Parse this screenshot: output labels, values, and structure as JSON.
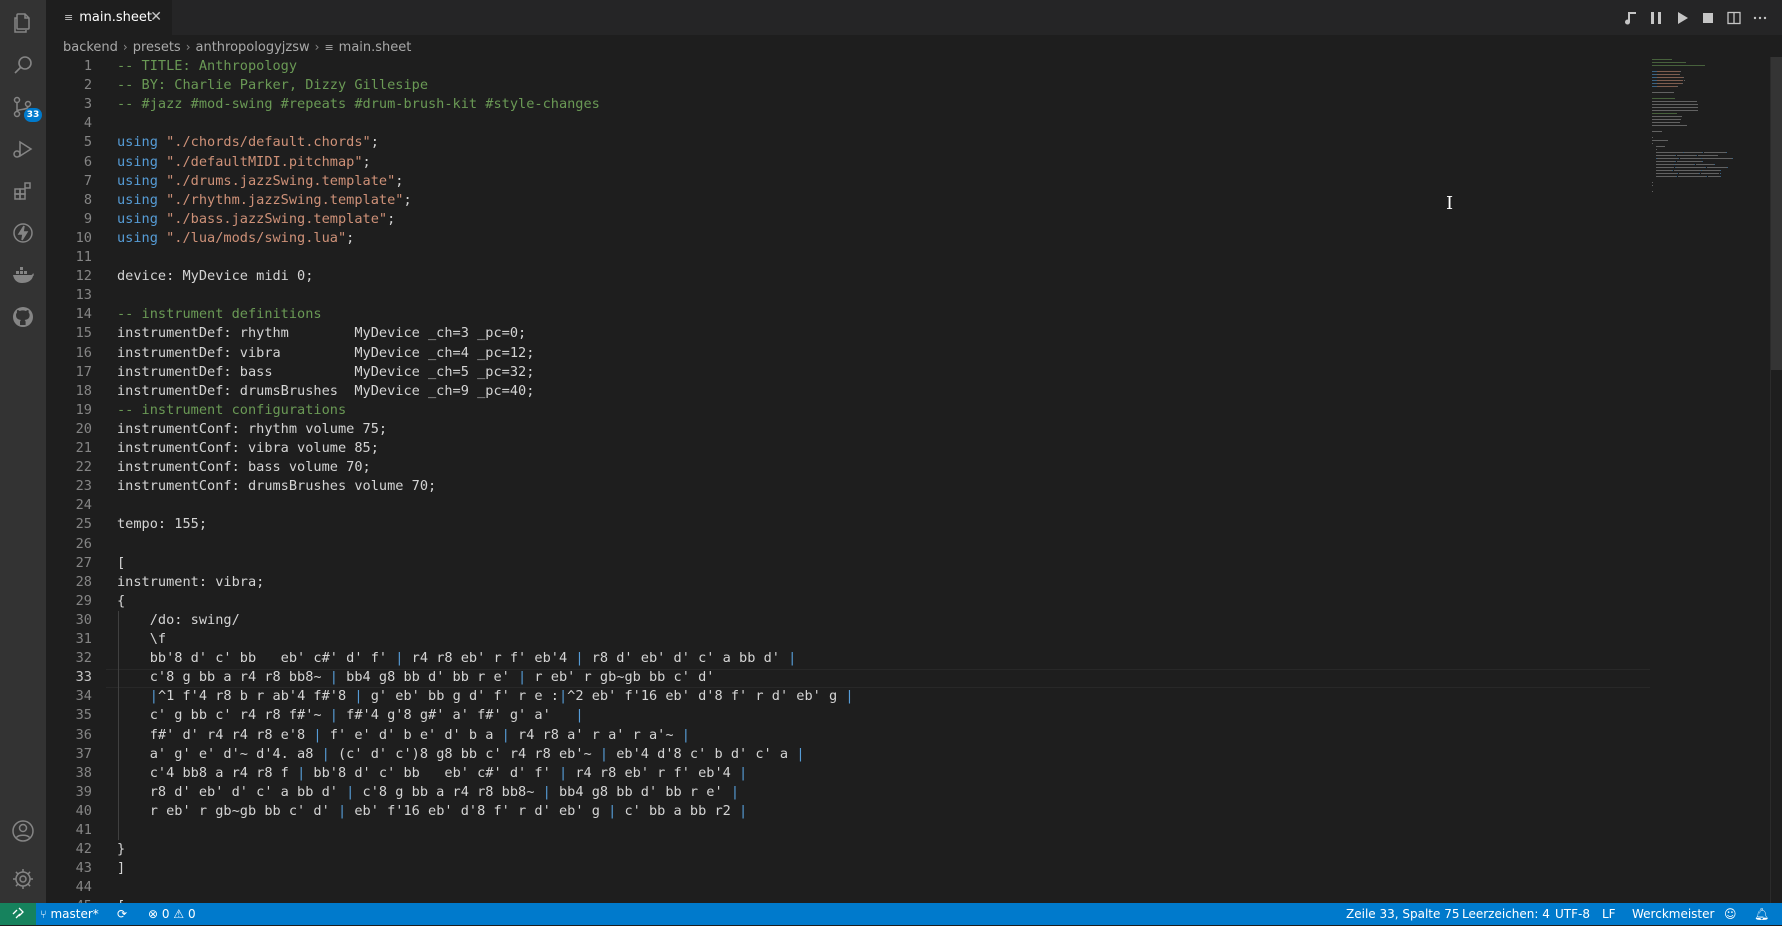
{
  "tab": {
    "label": "main.sheet"
  },
  "breadcrumb": [
    "backend",
    "presets",
    "anthropologyjzsw",
    "main.sheet"
  ],
  "activity_bar": {
    "icons": [
      "files-icon",
      "search-icon",
      "source-control-icon",
      "run-debug-icon",
      "extensions-icon",
      "lightning-icon",
      "docker-icon",
      "github-icon"
    ],
    "source_control_badge": "33",
    "bottom_icons": [
      "account-icon",
      "settings-gear-icon"
    ]
  },
  "toolbar_icons": [
    "music-note-icon",
    "pause-icon",
    "play-icon",
    "stop-icon",
    "split-editor-icon",
    "more-actions-icon"
  ],
  "editor": {
    "active_line": 33,
    "lines": [
      [
        [
          "c",
          "-- TITLE: Anthropology"
        ]
      ],
      [
        [
          "c",
          "-- BY: Charlie Parker, Dizzy Gillesipe"
        ]
      ],
      [
        [
          "c",
          "-- #jazz #mod-swing #repeats #drum-brush-kit #style-changes"
        ]
      ],
      [],
      [
        [
          "k",
          "using "
        ],
        [
          "s",
          "\"./chords/default.chords\""
        ],
        [
          "t",
          ";"
        ]
      ],
      [
        [
          "k",
          "using "
        ],
        [
          "s",
          "\"./defaultMIDI.pitchmap\""
        ],
        [
          "t",
          ";"
        ]
      ],
      [
        [
          "k",
          "using "
        ],
        [
          "s",
          "\"./drums.jazzSwing.template\""
        ],
        [
          "t",
          ";"
        ]
      ],
      [
        [
          "k",
          "using "
        ],
        [
          "s",
          "\"./rhythm.jazzSwing.template\""
        ],
        [
          "t",
          ";"
        ]
      ],
      [
        [
          "k",
          "using "
        ],
        [
          "s",
          "\"./bass.jazzSwing.template\""
        ],
        [
          "t",
          ";"
        ]
      ],
      [
        [
          "k",
          "using "
        ],
        [
          "s",
          "\"./lua/mods/swing.lua\""
        ],
        [
          "t",
          ";"
        ]
      ],
      [],
      [
        [
          "t",
          "device: MyDevice midi 0;"
        ]
      ],
      [],
      [
        [
          "c",
          "-- instrument definitions"
        ]
      ],
      [
        [
          "t",
          "instrumentDef: rhythm        MyDevice _ch=3 _pc=0;"
        ]
      ],
      [
        [
          "t",
          "instrumentDef: vibra         MyDevice _ch=4 _pc=12;"
        ]
      ],
      [
        [
          "t",
          "instrumentDef: bass          MyDevice _ch=5 _pc=32;"
        ]
      ],
      [
        [
          "t",
          "instrumentDef: drumsBrushes  MyDevice _ch=9 _pc=40;"
        ]
      ],
      [
        [
          "c",
          "-- instrument configurations"
        ]
      ],
      [
        [
          "t",
          "instrumentConf: rhythm volume 75;"
        ]
      ],
      [
        [
          "t",
          "instrumentConf: vibra volume 85;"
        ]
      ],
      [
        [
          "t",
          "instrumentConf: bass volume 70;"
        ]
      ],
      [
        [
          "t",
          "instrumentConf: drumsBrushes volume 70;"
        ]
      ],
      [],
      [
        [
          "t",
          "tempo: 155;"
        ]
      ],
      [],
      [
        [
          "t",
          "["
        ]
      ],
      [
        [
          "t",
          "instrument: vibra;"
        ]
      ],
      [
        [
          "t",
          "{"
        ]
      ],
      [
        [
          "t",
          "    /do: swing/"
        ]
      ],
      [
        [
          "t",
          "    \\f"
        ]
      ],
      [
        [
          "t",
          "    bb'8 d' c' bb   eb' c#' d' f' "
        ],
        [
          "b",
          "|"
        ],
        [
          "t",
          " r4 r8 eb' r f' eb'4 "
        ],
        [
          "b",
          "|"
        ],
        [
          "t",
          " r8 d' eb' d' c' a bb d' "
        ],
        [
          "b",
          "|"
        ]
      ],
      [
        [
          "t",
          "    c'8 g bb a r4 r8 bb8~ "
        ],
        [
          "b",
          "|"
        ],
        [
          "t",
          " bb4 g8 bb d' bb r e' "
        ],
        [
          "b",
          "|"
        ],
        [
          "t",
          " r eb' r gb~gb bb c' d'"
        ]
      ],
      [
        [
          "t",
          "    "
        ],
        [
          "b",
          "|"
        ],
        [
          "t",
          "^1 f'4 r8 b r ab'4 f#'8 "
        ],
        [
          "b",
          "|"
        ],
        [
          "t",
          " g' eb' bb g d' f' r e :"
        ],
        [
          "b",
          "|"
        ],
        [
          "t",
          "^2 eb' f'16 eb' d'8 f' r d' eb' g "
        ],
        [
          "b",
          "|"
        ]
      ],
      [
        [
          "t",
          "    c' g bb c' r4 r8 f#'~ "
        ],
        [
          "b",
          "|"
        ],
        [
          "t",
          " f#'4 g'8 g#' a' f#' g' a'   "
        ],
        [
          "b",
          "|"
        ]
      ],
      [
        [
          "t",
          "    f#' d' r4 r4 r8 e'8 "
        ],
        [
          "b",
          "|"
        ],
        [
          "t",
          " f' e' d' b e' d' b a "
        ],
        [
          "b",
          "|"
        ],
        [
          "t",
          " r4 r8 a' r a' r a'~ "
        ],
        [
          "b",
          "|"
        ]
      ],
      [
        [
          "t",
          "    a' g' e' d'~ d'4. a8 "
        ],
        [
          "b",
          "|"
        ],
        [
          "t",
          " (c' d' c')8 g8 bb c' r4 r8 eb'~ "
        ],
        [
          "b",
          "|"
        ],
        [
          "t",
          " eb'4 d'8 c' b d' c' a "
        ],
        [
          "b",
          "|"
        ]
      ],
      [
        [
          "t",
          "    c'4 bb8 a r4 r8 f "
        ],
        [
          "b",
          "|"
        ],
        [
          "t",
          " bb'8 d' c' bb   eb' c#' d' f' "
        ],
        [
          "b",
          "|"
        ],
        [
          "t",
          " r4 r8 eb' r f' eb'4 "
        ],
        [
          "b",
          "|"
        ]
      ],
      [
        [
          "t",
          "    r8 d' eb' d' c' a bb d' "
        ],
        [
          "b",
          "|"
        ],
        [
          "t",
          " c'8 g bb a r4 r8 bb8~ "
        ],
        [
          "b",
          "|"
        ],
        [
          "t",
          " bb4 g8 bb d' bb r e' "
        ],
        [
          "b",
          "|"
        ]
      ],
      [
        [
          "t",
          "    r eb' r gb~gb bb c' d' "
        ],
        [
          "b",
          "|"
        ],
        [
          "t",
          " eb' f'16 eb' d'8 f' r d' eb' g "
        ],
        [
          "b",
          "|"
        ],
        [
          "t",
          " c' bb a bb r2 "
        ],
        [
          "b",
          "|"
        ]
      ],
      [],
      [
        [
          "t",
          "}"
        ]
      ],
      [
        [
          "t",
          "]"
        ]
      ],
      [],
      [
        [
          "t",
          "["
        ]
      ]
    ]
  },
  "status_bar": {
    "branch": "master*",
    "errors": "0",
    "warnings": "0",
    "position": "Zeile 33, Spalte 75",
    "indent": "Leerzeichen: 4",
    "encoding": "UTF-8",
    "eol": "LF",
    "language": "Werckmeister"
  },
  "colors": {
    "comment": "#6a9955",
    "keyword": "#569cd6",
    "string": "#ce9178",
    "text": "#d4d4d4",
    "statusbar": "#007acc",
    "remote": "#16825d"
  }
}
